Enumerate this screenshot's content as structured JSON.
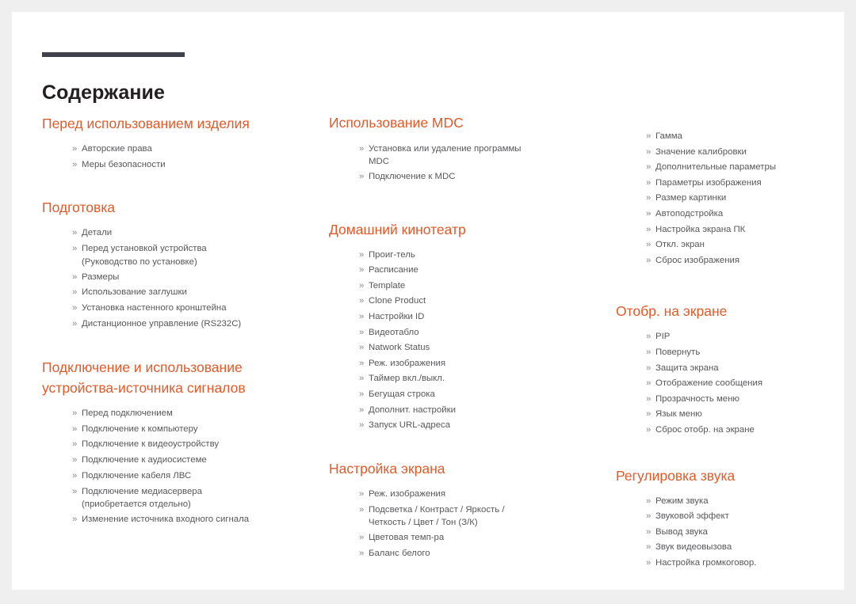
{
  "document": {
    "title": "Содержание",
    "bullet_glyph": "»",
    "accent_color": "#df5b2a",
    "rule_color": "#3f414d",
    "title_color": "#231f20",
    "item_color": "#58585b",
    "page_background": "#ffffff",
    "canvas_background": "#efefef"
  },
  "columns": [
    {
      "sections": [
        {
          "heading": "Перед использованием изделия",
          "gap_before": 0,
          "items": [
            "Авторские права",
            "Меры безопасности"
          ]
        },
        {
          "heading": "Подготовка",
          "gap_before": 32,
          "items": [
            "Детали",
            "Перед установкой устройства\n(Руководство по установке)",
            "Размеры",
            "Использование заглушки",
            "Установка настенного кронштейна",
            "Дистанционное управление (RS232C)"
          ]
        },
        {
          "heading": "Подключение и использование устройства-источника сигналов",
          "gap_before": 32,
          "items": [
            "Перед подключением",
            "Подключение к компьютеру",
            "Подключение к видеоустройству",
            "Подключение к аудиосистеме",
            "Подключение кабеля ЛВС",
            "Подключение медиасервера\n(приобретается отдельно)",
            "Изменение источника входного сигнала"
          ]
        }
      ]
    },
    {
      "sections": [
        {
          "heading": "Использование MDC",
          "gap_before": 0,
          "items": [
            "Установка или удаление программы\nMDC",
            "Подключение к MDC"
          ]
        },
        {
          "heading": "Домашний кинотеатр",
          "gap_before": 44,
          "items": [
            "Проиг-тель",
            "Расписание",
            "Template",
            "Clone Product",
            "Настройки ID",
            "Видеотабло",
            "Natwork Status",
            "Реж. изображения",
            "Таймер вкл./выкл.",
            "Бегущая строка",
            "Дополнит. настройки",
            "Запуск URL-адреса"
          ]
        },
        {
          "heading": "Настройка экрана",
          "gap_before": 32,
          "items": [
            "Реж. изображения",
            "Подсветка / Контраст / Яркость /\nЧеткость / Цвет / Тон (З/К)",
            "Цветовая темп-ра",
            "Баланс белого"
          ]
        }
      ]
    },
    {
      "sections": [
        {
          "heading": "",
          "gap_before": 20,
          "items": [
            "Гамма",
            "Значение калибровки",
            "Дополнительные параметры",
            "Параметры изображения",
            "Размер картинки",
            "Автоподстройка",
            "Настройка экрана ПК",
            "Откл. экран",
            "Сброс изображения"
          ]
        },
        {
          "heading": "Отобр. на экране",
          "gap_before": 42,
          "items": [
            "PIP",
            "Повернуть",
            "Защита экрана",
            "Отображение сообщения",
            "Прозрачность меню",
            "Язык меню",
            "Сброс отобр. на экране"
          ]
        },
        {
          "heading": "Регулировка звука",
          "gap_before": 35,
          "items": [
            "Режим звука",
            "Звуковой эффект",
            "Вывод звука",
            "Звук видеовызова",
            "Настройка громкоговор."
          ]
        }
      ]
    }
  ]
}
